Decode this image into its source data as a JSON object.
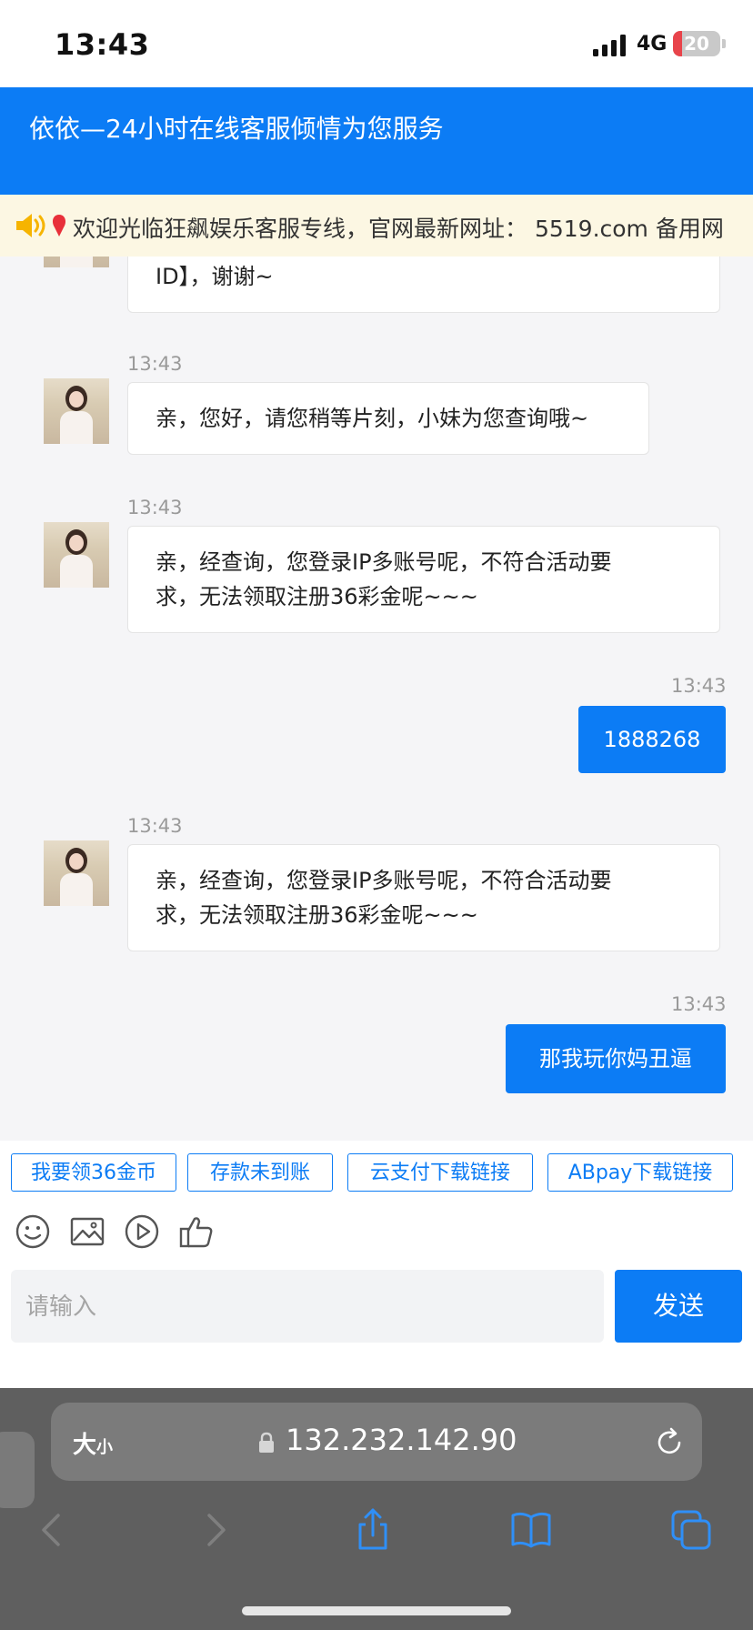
{
  "status_bar": {
    "time": "13:43",
    "network": "4G",
    "battery": "20",
    "battery_level": 0.2
  },
  "header": {
    "title": "依依—24小时在线客服倾情为您服务"
  },
  "notice": {
    "text": "欢迎光临狂飙娱乐客服专线，官网最新网址： 5519.com 备用网"
  },
  "chat": {
    "partial_message": "ID】，谢谢~",
    "messages": [
      {
        "time": "13:43",
        "text": "亲，您好，请您稍等片刻，小妹为您查询哦~"
      },
      {
        "time": "13:43",
        "line1": "亲，经查询，您登录IP多账号呢，不符合活动要",
        "line2": "求，无法领取注册36彩金呢~~~"
      },
      {
        "time": "13:43",
        "text": "1888268"
      },
      {
        "time": "13:43",
        "line1": "亲，经查询，您登录IP多账号呢，不符合活动要",
        "line2": "求，无法领取注册36彩金呢~~~"
      },
      {
        "time": "13:43",
        "text": "那我玩你妈丑逼"
      }
    ]
  },
  "quick_replies": [
    "我要领36金币",
    "存款未到账",
    "云支付下载链接",
    "ABpay下载链接"
  ],
  "toolbar": {
    "icons": [
      "smile-icon",
      "image-icon",
      "video-icon",
      "thumbs-up-icon"
    ]
  },
  "input": {
    "placeholder": "请输入",
    "send_label": "发送"
  },
  "browser": {
    "text_size_big": "大",
    "text_size_small": "小",
    "url": "132.232.142.90"
  },
  "colors": {
    "accent": "#0c7cf5",
    "notice_bg": "#fcf7e3",
    "chat_bg": "#f5f5f7"
  }
}
